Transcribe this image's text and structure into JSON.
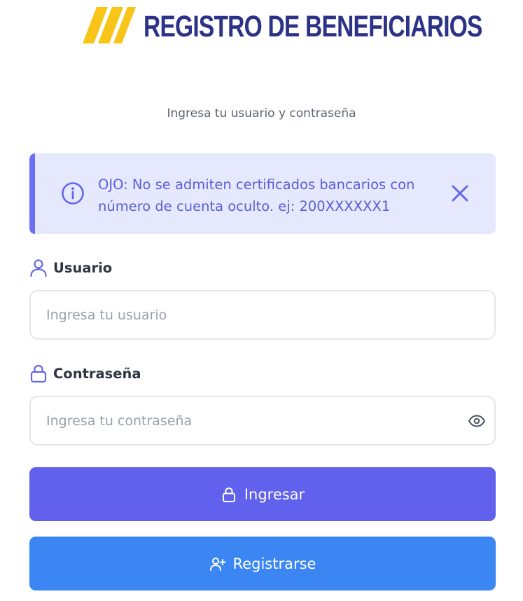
{
  "header": {
    "title": "REGISTRO DE BENEFICIARIOS",
    "logo_icon": "triple-slash-logo-icon",
    "logo_color": "#f7c417",
    "title_color": "#2b3288"
  },
  "subtitle": "Ingresa tu usuario y contraseña",
  "alert": {
    "text": "OJO: No se admiten certificados bancarios con número de cuenta oculto. ej: 200XXXXXX1",
    "icon": "info-icon",
    "close_icon": "close-icon",
    "background": "#e6e8fd",
    "accent": "#6d6ff2"
  },
  "form": {
    "username": {
      "label": "Usuario",
      "icon": "user-icon",
      "placeholder": "Ingresa tu usuario",
      "value": ""
    },
    "password": {
      "label": "Contraseña",
      "icon": "lock-icon",
      "placeholder": "Ingresa tu contraseña",
      "value": "",
      "toggle_icon": "eye-icon"
    }
  },
  "buttons": {
    "login": {
      "label": "Ingresar",
      "icon": "lock-icon",
      "color": "#6161ee"
    },
    "register": {
      "label": "Registrarse",
      "icon": "user-plus-icon",
      "color": "#3b86f3"
    }
  }
}
